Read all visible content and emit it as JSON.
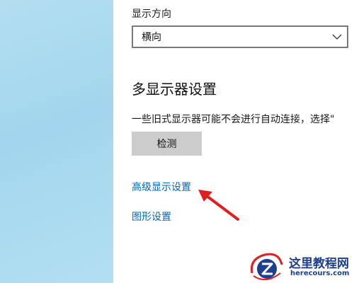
{
  "colors": {
    "left_panel": "#a9d9ef",
    "link": "#0067c0",
    "button_bg": "#cccccc",
    "arrow": "#e02020",
    "watermark": "#1d3f8f"
  },
  "orientation": {
    "label": "显示方向",
    "selected": "横向",
    "icon": "chevron-down-icon"
  },
  "multi_display": {
    "title": "多显示器设置",
    "description": "一些旧式显示器可能不会进行自动连接，选择\"",
    "detect_label": "检测"
  },
  "links": {
    "advanced": "高级显示设置",
    "graphics": "图形设置"
  },
  "watermark": {
    "name": "这里教程网",
    "domain": "herecours.com"
  }
}
